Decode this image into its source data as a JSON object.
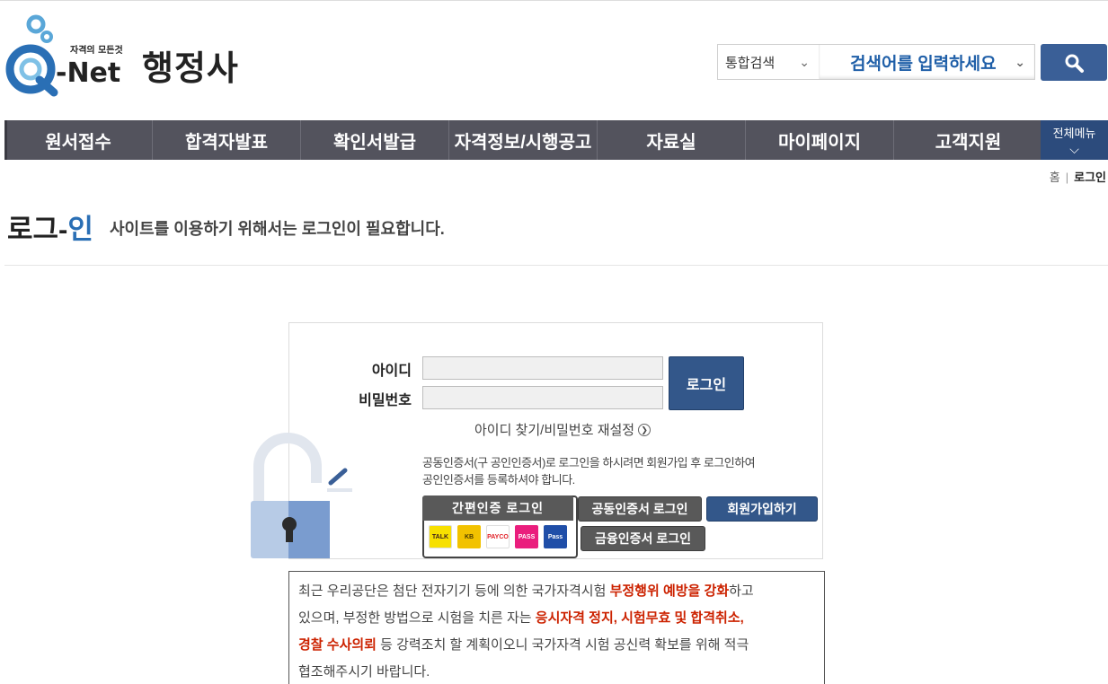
{
  "header": {
    "logo_tagline": "자격의 모든것",
    "logo_text": "Q-Net",
    "site_title": "행정사",
    "search_scope": "통합검색",
    "search_placeholder": "검색어를 입력하세요"
  },
  "nav": {
    "items": [
      {
        "label": "원서접수"
      },
      {
        "label": "합격자발표"
      },
      {
        "label": "확인서발급"
      },
      {
        "label": "자격정보/시행공고"
      },
      {
        "label": "자료실"
      },
      {
        "label": "마이페이지"
      },
      {
        "label": "고객지원"
      }
    ],
    "all_menu": "전체메뉴"
  },
  "breadcrumb": {
    "home": "홈",
    "separator": "|",
    "current": "로그인"
  },
  "page": {
    "title_part1": "로그-",
    "title_part2": "인",
    "description": "사이트를 이용하기 위해서는 로그인이 필요합니다."
  },
  "login": {
    "id_label": "아이디",
    "password_label": "비밀번호",
    "login_button": "로그인",
    "find_link": "아이디 찾기/비밀번호 재설정",
    "cert_note_line1": "공동인증서(구 공인인증서)로 로그인을 하시려면 회원가입 후 로그인하여",
    "cert_note_line2": "공인인증서를 등록하셔야 합니다.",
    "simple_auth_button": "간편인증 로그인",
    "joint_cert_button": "공동인증서 로그인",
    "join_button": "회원가입하기",
    "financial_cert_button": "금융인증서 로그인",
    "apps": [
      {
        "name": "kakao-icon",
        "text": "TALK",
        "bg": "#f7e000",
        "fg": "#3a1d1d"
      },
      {
        "name": "kb-icon",
        "text": "KB",
        "bg": "#f2c200",
        "fg": "#4a3a00"
      },
      {
        "name": "payco-icon",
        "text": "PAYCO",
        "bg": "#ffffff",
        "fg": "#e01f26"
      },
      {
        "name": "pass-icon",
        "text": "PASS",
        "bg": "#ea1e7d",
        "fg": "#ffffff"
      },
      {
        "name": "samsung-pass-icon",
        "text": "Pass",
        "bg": "#1f4ea8",
        "fg": "#ffffff"
      }
    ]
  },
  "notice": {
    "p1": "최근 우리공단은 첨단 전자기기 등에 의한 국가자격시험 ",
    "r1": "부정행위 예방을 강화",
    "p2": "하고",
    "p3": "있으며, 부정한 방법으로 시험을 치른 자는 ",
    "r2": "응시자격 정지, 시험무효 및 합격취소,",
    "r3": "경찰 수사의뢰",
    "p4": " 등 강력조치 할 계획이오니 국가자격 시험 공신력 확보를 위해 적극",
    "p5": "협조해주시기 바랍니다."
  },
  "colors": {
    "nav_bg": "#53535d",
    "accent_blue": "#2a6fb5",
    "button_blue": "#33578a",
    "warning_red": "#cc2200"
  }
}
